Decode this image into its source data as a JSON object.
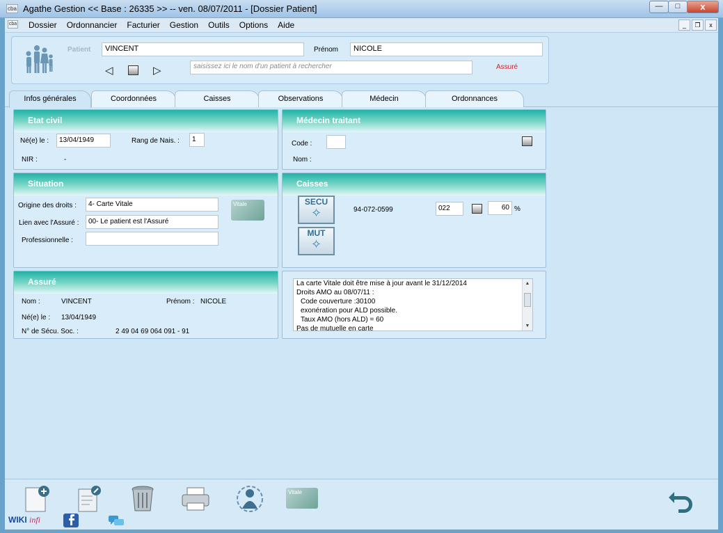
{
  "window": {
    "title": "Agathe Gestion << Base : 26335 >>   --   ven. 08/07/2011 - [Dossier Patient]",
    "app_badge": "cba",
    "minimize": "—",
    "maximize": "□",
    "close": "x"
  },
  "menu": {
    "badge": "cba",
    "items": [
      "Dossier",
      "Ordonnancier",
      "Facturier",
      "Gestion",
      "Outils",
      "Options",
      "Aide"
    ],
    "mdi_min": "_",
    "mdi_restore": "❐",
    "mdi_close": "x"
  },
  "patient": {
    "label": "Patient",
    "name": "VINCENT",
    "firstname_label": "Prénom",
    "firstname": "NICOLE",
    "search_placeholder": "saisissez ici le nom d'un patient à rechercher",
    "status": "Assuré",
    "prev": "◁",
    "next": "▷"
  },
  "tabs": [
    "Infos générales",
    "Coordonnées",
    "Caisses",
    "Observations",
    "Médecin",
    "Ordonnances"
  ],
  "etat_civil": {
    "title": "Etat civil",
    "born_label": "Né(e) le :",
    "born_value": "13/04/1949",
    "rank_label": "Rang de Nais. :",
    "rank_value": "1",
    "nir_label": "NIR :",
    "nir_value": "-"
  },
  "medecin": {
    "title": "Médecin traitant",
    "code_label": "Code :",
    "code_value": "",
    "nom_label": "Nom :"
  },
  "situation": {
    "title": "Situation",
    "origine_label": "Origine des droits :",
    "origine_value": "4- Carte Vitale",
    "lien_label": "Lien avec l'Assuré :",
    "lien_value": "00- Le patient est l'Assuré",
    "pro_label": "Professionnelle :",
    "pro_value": "",
    "vitale_text": "Vitale"
  },
  "caisses": {
    "title": "Caisses",
    "secu_label": "SECU",
    "mut_label": "MUT",
    "caisse_number": "94-072-0599",
    "code": "022",
    "rate": "60",
    "rate_unit": "%"
  },
  "assure": {
    "title": "Assuré",
    "nom_label": "Nom :",
    "nom_value": "VINCENT",
    "prenom_label": "Prénom :",
    "prenom_value": "NICOLE",
    "born_label": "Né(e) le :",
    "born_value": "13/04/1949",
    "secu_label": "N° de Sécu. Soc. :",
    "secu_value": "2 49 04 69 064 091 - 91"
  },
  "vitale_info": {
    "lines": [
      "La carte Vitale doit être mise à jour avant le 31/12/2014",
      "Droits AMO au 08/07/11 :",
      "   Code couverture :30100",
      "   exonération pour ALD possible.",
      "   Taux AMO (hors ALD) = 60",
      "Pas de mutuelle en carte"
    ]
  },
  "footer": {
    "wiki": "WIKI",
    "infi": "infi",
    "vitale_text": "Vitale"
  },
  "colors": {
    "panel_head": "#1fb3a6",
    "background": "#cfe6f7",
    "status_red": "#d0202a"
  }
}
